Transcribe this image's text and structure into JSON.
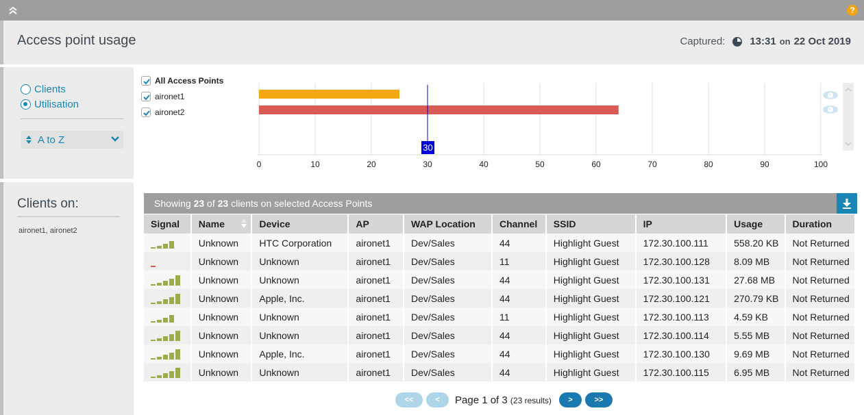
{
  "header": {
    "title": "Access point usage",
    "captured_label": "Captured:",
    "time": "13:31",
    "on": "on",
    "date": "22 Oct 2019",
    "help_glyph": "?"
  },
  "view_options": {
    "radios": [
      {
        "label": "Clients",
        "checked": false
      },
      {
        "label": "Utilisation",
        "checked": true
      }
    ],
    "sort": {
      "selected": "A to Z"
    }
  },
  "access_points": {
    "all_label": "All Access Points",
    "all_checked": true,
    "items": [
      {
        "name": "aironet1",
        "checked": true,
        "color": "#f2a813"
      },
      {
        "name": "aironet2",
        "checked": true,
        "color": "#d95b55"
      }
    ]
  },
  "chart_data": {
    "type": "bar",
    "orientation": "horizontal",
    "categories": [
      "aironet1",
      "aironet2"
    ],
    "values": [
      25,
      64
    ],
    "colors": [
      "#f2a813",
      "#d95b55"
    ],
    "xlim": [
      0,
      100
    ],
    "xticks": [
      0,
      10,
      20,
      30,
      40,
      50,
      60,
      70,
      80,
      90,
      100
    ],
    "grid": true,
    "marker": {
      "value": 30,
      "label": "30",
      "color": "#0000dd"
    }
  },
  "clients_panel": {
    "title": "Clients on:",
    "aps": "aironet1, aironet2"
  },
  "table": {
    "summary_prefix": "Showing ",
    "shown": "23",
    "of": " of ",
    "total": "23",
    "summary_suffix": " clients on selected Access Points",
    "columns": [
      "Signal",
      "Name",
      "Device",
      "AP",
      "WAP Location",
      "Channel",
      "SSID",
      "IP",
      "Usage",
      "Duration"
    ],
    "signal_colors": {
      "good": "#9aad4a",
      "poor": "#d95b55"
    },
    "rows": [
      {
        "signal": 4,
        "name": "Unknown",
        "device": "HTC Corporation",
        "ap": "aironet1",
        "location": "Dev/Sales",
        "channel": "44",
        "ssid": "Highlight Guest",
        "ip": "172.30.100.111",
        "usage": "558.20 KB",
        "duration": "Not Returned"
      },
      {
        "signal": 1,
        "name": "Unknown",
        "device": "Unknown",
        "ap": "aironet1",
        "location": "Dev/Sales",
        "channel": "11",
        "ssid": "Highlight Guest",
        "ip": "172.30.100.128",
        "usage": "8.09 MB",
        "duration": "Not Returned"
      },
      {
        "signal": 5,
        "name": "Unknown",
        "device": "Unknown",
        "ap": "aironet1",
        "location": "Dev/Sales",
        "channel": "44",
        "ssid": "Highlight Guest",
        "ip": "172.30.100.131",
        "usage": "27.68 MB",
        "duration": "Not Returned"
      },
      {
        "signal": 5,
        "name": "Unknown",
        "device": "Apple, Inc.",
        "ap": "aironet1",
        "location": "Dev/Sales",
        "channel": "44",
        "ssid": "Highlight Guest",
        "ip": "172.30.100.121",
        "usage": "270.79 KB",
        "duration": "Not Returned"
      },
      {
        "signal": 4,
        "name": "Unknown",
        "device": "Unknown",
        "ap": "aironet1",
        "location": "Dev/Sales",
        "channel": "11",
        "ssid": "Highlight Guest",
        "ip": "172.30.100.113",
        "usage": "4.59 KB",
        "duration": "Not Returned"
      },
      {
        "signal": 5,
        "name": "Unknown",
        "device": "Unknown",
        "ap": "aironet1",
        "location": "Dev/Sales",
        "channel": "44",
        "ssid": "Highlight Guest",
        "ip": "172.30.100.114",
        "usage": "5.55 MB",
        "duration": "Not Returned"
      },
      {
        "signal": 5,
        "name": "Unknown",
        "device": "Apple, Inc.",
        "ap": "aironet1",
        "location": "Dev/Sales",
        "channel": "44",
        "ssid": "Highlight Guest",
        "ip": "172.30.100.130",
        "usage": "9.69 MB",
        "duration": "Not Returned"
      },
      {
        "signal": 5,
        "name": "Unknown",
        "device": "Unknown",
        "ap": "aironet1",
        "location": "Dev/Sales",
        "channel": "44",
        "ssid": "Highlight Guest",
        "ip": "172.30.100.115",
        "usage": "6.95 MB",
        "duration": "Not Returned"
      }
    ]
  },
  "pagination": {
    "first_label": "<<",
    "prev_label": "<",
    "next_label": ">",
    "last_label": ">>",
    "page_text": "Page 1 of 3",
    "results_text": "(23 results)",
    "current_page": 1,
    "total_pages": 3
  }
}
